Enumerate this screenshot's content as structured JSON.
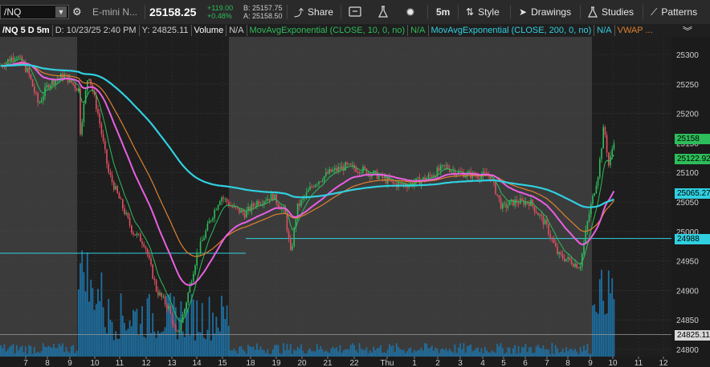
{
  "toolbar": {
    "symbol": "/NQ",
    "instrument": "E-mini N...",
    "last_price": "25158.25",
    "change": "+119.00",
    "change_pct": "+0.48%",
    "bid": "B: 25157.75",
    "ask": "A: 25158.50",
    "share": "Share",
    "interval": "5m",
    "style": "Style",
    "drawings": "Drawings",
    "studies": "Studies",
    "patterns": "Patterns"
  },
  "chart_header": {
    "symbol_period": "/NQ 5 D 5m",
    "date": "D: 10/23/25 2:40 PM",
    "y_value": "Y: 24825.11",
    "volume": "Volume",
    "volume_na": "N/A",
    "ema10": "MovAvgExponential (CLOSE, 10, 0, no)",
    "ema10_na": "N/A",
    "ema200": "MovAvgExponential (CLOSE, 200, 0, no)",
    "ema200_na": "N/A",
    "vwap": "VWAP ..."
  },
  "chart_data": {
    "type": "candlestick",
    "x_ticks": [
      "7",
      "8",
      "9",
      "10",
      "11",
      "12",
      "13",
      "14",
      "15",
      "18",
      "19",
      "20",
      "21",
      "22",
      "Thu",
      "1",
      "2",
      "3",
      "4",
      "5",
      "6",
      "7",
      "8",
      "9",
      "10",
      "11",
      "12"
    ],
    "y_ticks": [
      25300,
      25250,
      25200,
      25150,
      25100,
      25050,
      25000,
      24950,
      24900,
      24850,
      24800
    ],
    "ylim": [
      24785,
      25330
    ],
    "price_labels": [
      {
        "text": "25158",
        "value": 25158,
        "color": "#2dbd5a"
      },
      {
        "text": "25122.92",
        "value": 25122.92,
        "color": "#2dbd5a"
      },
      {
        "text": "25065.27",
        "value": 25065.27,
        "color": "#30d0e0"
      },
      {
        "text": "24988",
        "value": 24988,
        "color": "#30d0e0"
      },
      {
        "text": "24825.11",
        "value": 24825.11,
        "color": "#d8d8d8"
      }
    ],
    "horizontal_lines": [
      {
        "value": 24988,
        "color": "#30d0e0"
      },
      {
        "value": 24963,
        "color": "#30d0e0"
      },
      {
        "value": 24825.11,
        "color": "#9a9a9a"
      }
    ],
    "series": [
      {
        "color": "#30d0e0"
      },
      {
        "color": "#e860e0"
      },
      {
        "color": "#e08030"
      }
    ],
    "colors": {
      "up": "#2dbd5a",
      "down": "#e05060",
      "volume": "#1f6fa0"
    }
  }
}
